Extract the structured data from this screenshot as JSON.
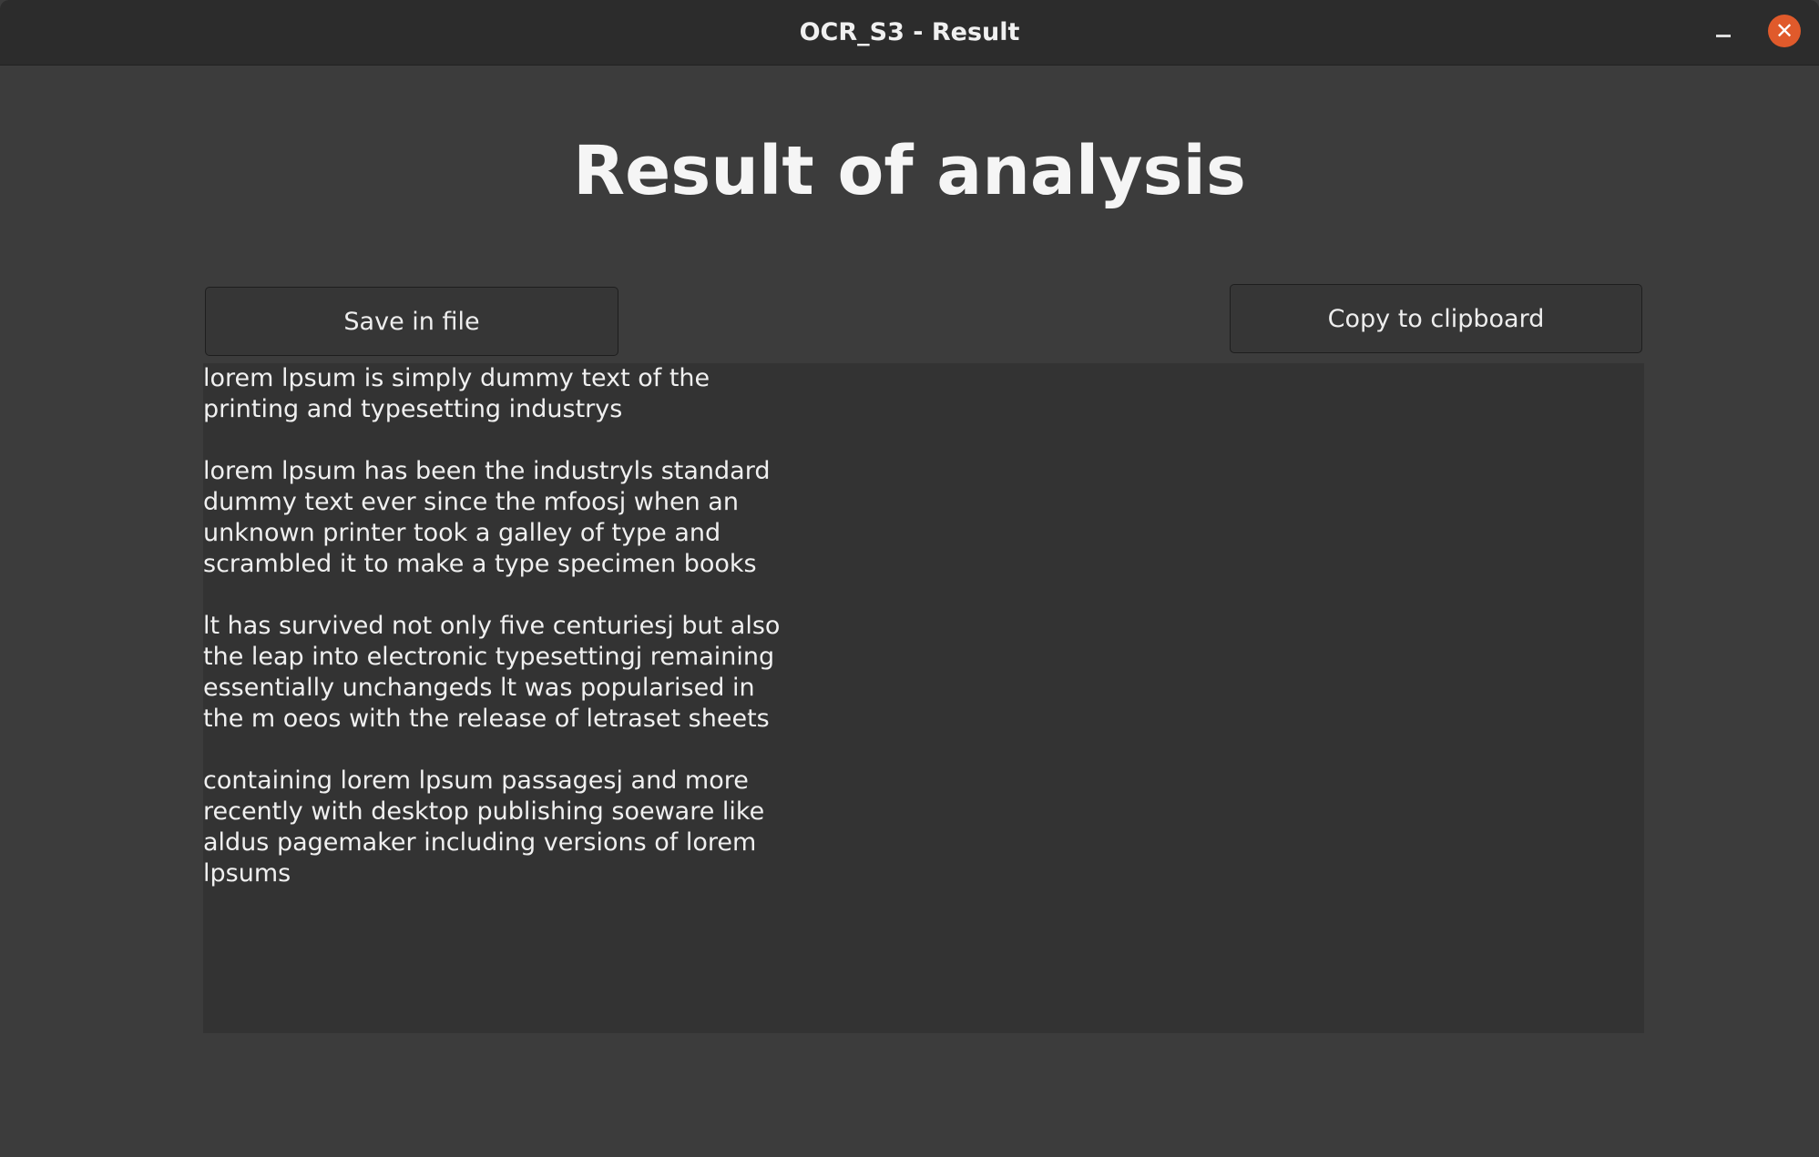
{
  "window": {
    "title": "OCR_S3 - Result",
    "minimize_label": "–",
    "close_label": "✕"
  },
  "heading": "Result of analysis",
  "buttons": {
    "save": "Save in file",
    "copy": "Copy to clipboard"
  },
  "result_paragraphs": [
    [
      "lorem lpsum is simply dummy text of the",
      "printing and typesetting industrys"
    ],
    [
      "lorem lpsum has been the industryls standard",
      "dummy text ever since the mfoosj when an",
      "unknown printer took a galley of type and",
      "scrambled it to make a type specimen books"
    ],
    [
      "lt has survived not only five centuriesj but also",
      "the leap into electronic typesettingj remaining",
      "essentially unchangeds lt was popularised in",
      "the m oeos with the release of letraset sheets"
    ],
    [
      "containing lorem lpsum passagesj and more",
      "recently with desktop publishing soeware like",
      "aldus pagemaker including versions of lorem",
      "lpsums"
    ]
  ]
}
